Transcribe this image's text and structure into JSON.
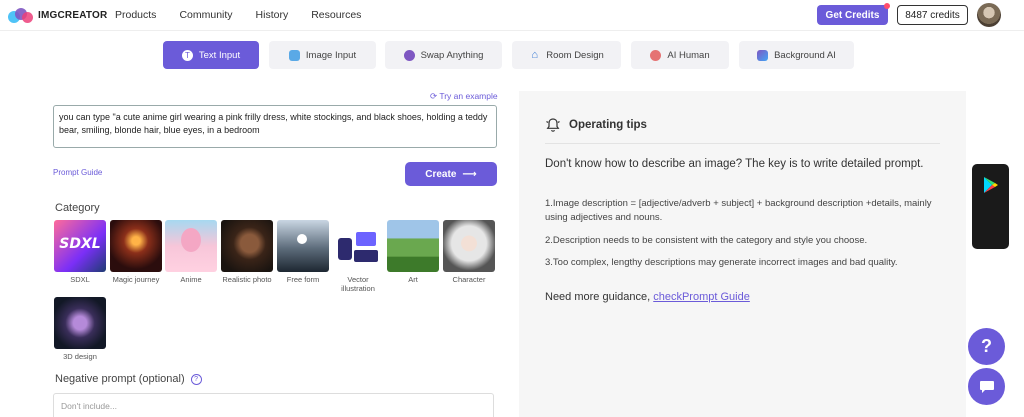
{
  "header": {
    "logo_text": "IMGCREATOR",
    "nav": [
      "Products",
      "Community",
      "History",
      "Resources"
    ],
    "get_credits": "Get Credits",
    "credits": "8487 credits"
  },
  "tabs": [
    {
      "label": "Text Input",
      "active": true
    },
    {
      "label": "Image Input",
      "active": false
    },
    {
      "label": "Swap Anything",
      "active": false
    },
    {
      "label": "Room Design",
      "active": false
    },
    {
      "label": "AI Human",
      "active": false
    },
    {
      "label": "Background AI",
      "active": false
    }
  ],
  "prompt": {
    "try_example": "Try an example",
    "value": "you can type \"a cute anime girl wearing a pink frilly dress, white stockings, and black shoes, holding a teddy bear, smiling, blonde hair, blue eyes, in a bedroom",
    "guide_link": "Prompt Guide",
    "create_label": "Create"
  },
  "category": {
    "title": "Category",
    "items": [
      {
        "label": "SDXL"
      },
      {
        "label": "Magic journey"
      },
      {
        "label": "Anime"
      },
      {
        "label": "Realistic photo"
      },
      {
        "label": "Free form"
      },
      {
        "label": "Vector illustration"
      },
      {
        "label": "Art"
      },
      {
        "label": "Character"
      },
      {
        "label": "3D design"
      }
    ]
  },
  "negative": {
    "title": "Negative prompt (optional)",
    "placeholder": "Don't include..."
  },
  "tips": {
    "title": "Operating tips",
    "intro": "Don't know how to describe an image? The key is to write detailed prompt.",
    "items": [
      "1.Image description = [adjective/adverb + subject] + background description +details, mainly using adjectives and nouns.",
      "2.Description needs to be consistent with the category and style you choose.",
      "3.Too complex, lengthy descriptions may generate incorrect images and bad quality."
    ],
    "more_text": "Need more guidance, ",
    "more_link": "checkPrompt Guide"
  },
  "colors": {
    "accent": "#6b5bd9",
    "panel": "#f6f6f6"
  }
}
